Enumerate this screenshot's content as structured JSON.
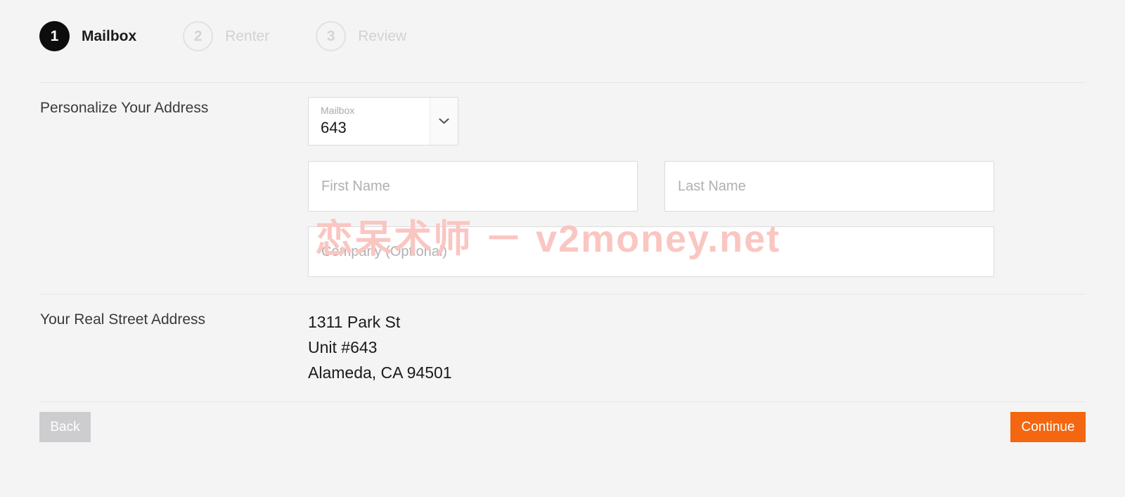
{
  "stepper": {
    "steps": [
      {
        "number": "1",
        "label": "Mailbox",
        "state": "active"
      },
      {
        "number": "2",
        "label": "Renter",
        "state": "inactive"
      },
      {
        "number": "3",
        "label": "Review",
        "state": "inactive"
      }
    ]
  },
  "sections": {
    "personalize_label": "Personalize Your Address",
    "address_label": "Your Real Street Address"
  },
  "mailbox_select": {
    "label": "Mailbox",
    "value": "643",
    "icon": "chevron-down-icon"
  },
  "inputs": {
    "first_name": {
      "value": "",
      "placeholder": "First Name"
    },
    "last_name": {
      "value": "",
      "placeholder": "Last Name"
    },
    "company": {
      "value": "",
      "placeholder": "Company (Optional)"
    }
  },
  "real_address": {
    "line1": "1311 Park St",
    "line2": "Unit #643",
    "line3": "Alameda, CA 94501"
  },
  "buttons": {
    "back": "Back",
    "continue": "Continue"
  },
  "watermark": {
    "text": "恋呆术师 － v2money.net"
  },
  "colors": {
    "accent_orange": "#f4660f",
    "back_gray": "#cdcdd0",
    "page_background": "#f4f4f5",
    "active_step": "#0d0d0d",
    "watermark_pink": "#fac6c2"
  }
}
